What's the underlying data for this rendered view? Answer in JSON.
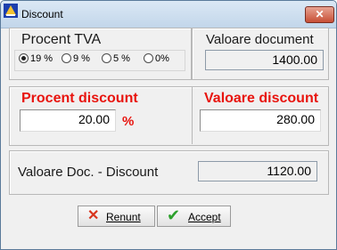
{
  "window": {
    "title": "Discount",
    "close_label": "✕"
  },
  "tva": {
    "label": "Procent TVA",
    "options": [
      "19 %",
      "9 %",
      "5 %",
      "0%"
    ],
    "selected": "19 %"
  },
  "doc": {
    "label": "Valoare document",
    "value": "1400.00"
  },
  "discount": {
    "percent_label": "Procent discount",
    "percent_value": "20.00",
    "percent_sign": "%",
    "value_label": "Valoare discount",
    "value": "280.00"
  },
  "result": {
    "label": "Valoare Doc. - Discount",
    "value": "1120.00"
  },
  "buttons": {
    "cancel": "Renunt",
    "accept": "Accept"
  },
  "colors": {
    "accent_red": "#e8140e"
  }
}
